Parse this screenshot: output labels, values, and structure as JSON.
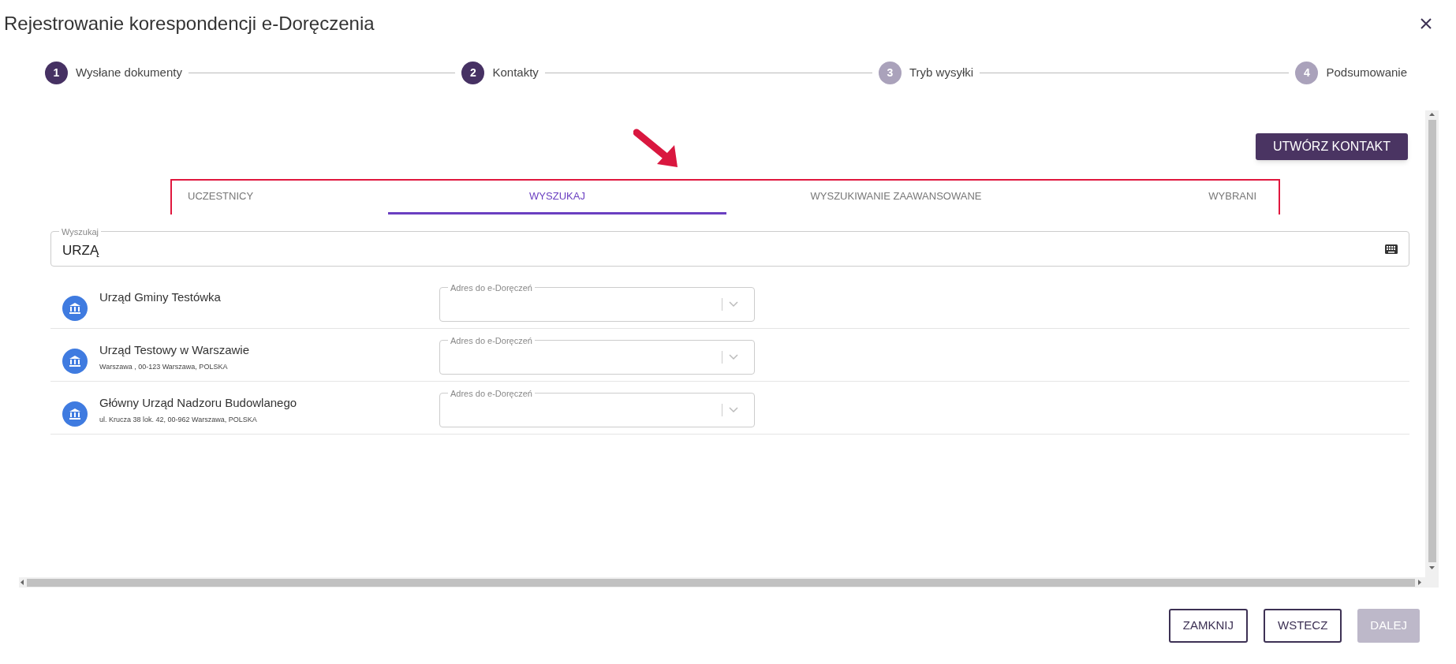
{
  "window": {
    "title": "Rejestrowanie korespondencji e-Doręczenia"
  },
  "steps": [
    {
      "number": "1",
      "label": "Wysłane dokumenty",
      "active": true
    },
    {
      "number": "2",
      "label": "Kontakty",
      "active": true
    },
    {
      "number": "3",
      "label": "Tryb wysyłki",
      "active": false
    },
    {
      "number": "4",
      "label": "Podsumowanie",
      "active": false
    }
  ],
  "create_button": "UTWÓRZ KONTAKT",
  "tabs": [
    {
      "label": "UCZESTNICY",
      "selected": false
    },
    {
      "label": "WYSZUKAJ",
      "selected": true
    },
    {
      "label": "WYSZUKIWANIE ZAAWANSOWANE",
      "selected": false
    },
    {
      "label": "WYBRANI",
      "selected": false
    }
  ],
  "search": {
    "label": "Wyszukaj",
    "value": "URZĄ"
  },
  "results": [
    {
      "name": "Urząd Gminy Testówka",
      "select_label": "Adres do e-Doręczeń"
    },
    {
      "name": "Urząd Testowy w Warszawie",
      "address": "Warszawa , 00-123 Warszawa, POLSKA",
      "select_label": "Adres do e-Doręczeń"
    },
    {
      "name": "Główny Urząd Nadzoru Budowlanego",
      "address": "ul. Krucza 38 lok. 42, 00-962 Warszawa, POLSKA",
      "select_label": "Adres do e-Doręczeń"
    }
  ],
  "buttons": [
    {
      "label": "ZAMKNIJ",
      "disabled": false
    },
    {
      "label": "WSTECZ",
      "disabled": false
    },
    {
      "label": "DALEJ",
      "disabled": true
    }
  ]
}
